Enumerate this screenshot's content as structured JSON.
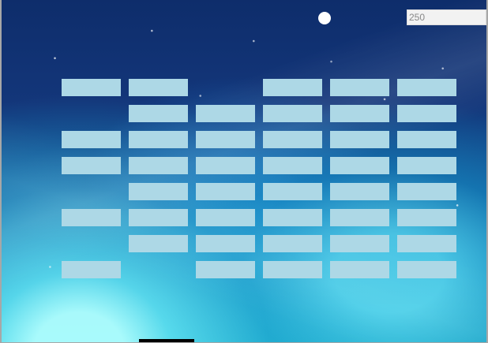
{
  "game": {
    "score": "250",
    "brick_color": "#add8e6",
    "ball_color": "#ffffff",
    "paddle_color": "#000000",
    "bricks": [
      {
        "row": 1,
        "col": 1
      },
      {
        "row": 1,
        "col": 2
      },
      {
        "row": 1,
        "col": 4
      },
      {
        "row": 1,
        "col": 5
      },
      {
        "row": 1,
        "col": 6
      },
      {
        "row": 2,
        "col": 2
      },
      {
        "row": 2,
        "col": 3
      },
      {
        "row": 2,
        "col": 4
      },
      {
        "row": 2,
        "col": 5
      },
      {
        "row": 2,
        "col": 6
      },
      {
        "row": 3,
        "col": 1
      },
      {
        "row": 3,
        "col": 2
      },
      {
        "row": 3,
        "col": 3
      },
      {
        "row": 3,
        "col": 4
      },
      {
        "row": 3,
        "col": 5
      },
      {
        "row": 3,
        "col": 6
      },
      {
        "row": 4,
        "col": 1
      },
      {
        "row": 4,
        "col": 2
      },
      {
        "row": 4,
        "col": 3
      },
      {
        "row": 4,
        "col": 4
      },
      {
        "row": 4,
        "col": 5
      },
      {
        "row": 4,
        "col": 6
      },
      {
        "row": 5,
        "col": 2
      },
      {
        "row": 5,
        "col": 3
      },
      {
        "row": 5,
        "col": 4
      },
      {
        "row": 5,
        "col": 5
      },
      {
        "row": 5,
        "col": 6
      },
      {
        "row": 6,
        "col": 1
      },
      {
        "row": 6,
        "col": 2
      },
      {
        "row": 6,
        "col": 3
      },
      {
        "row": 6,
        "col": 4
      },
      {
        "row": 6,
        "col": 5
      },
      {
        "row": 6,
        "col": 6
      },
      {
        "row": 7,
        "col": 2
      },
      {
        "row": 7,
        "col": 3
      },
      {
        "row": 7,
        "col": 4
      },
      {
        "row": 7,
        "col": 5
      },
      {
        "row": 7,
        "col": 6
      },
      {
        "row": 8,
        "col": 1
      },
      {
        "row": 8,
        "col": 3
      },
      {
        "row": 8,
        "col": 4
      },
      {
        "row": 8,
        "col": 5
      },
      {
        "row": 8,
        "col": 6
      }
    ]
  }
}
